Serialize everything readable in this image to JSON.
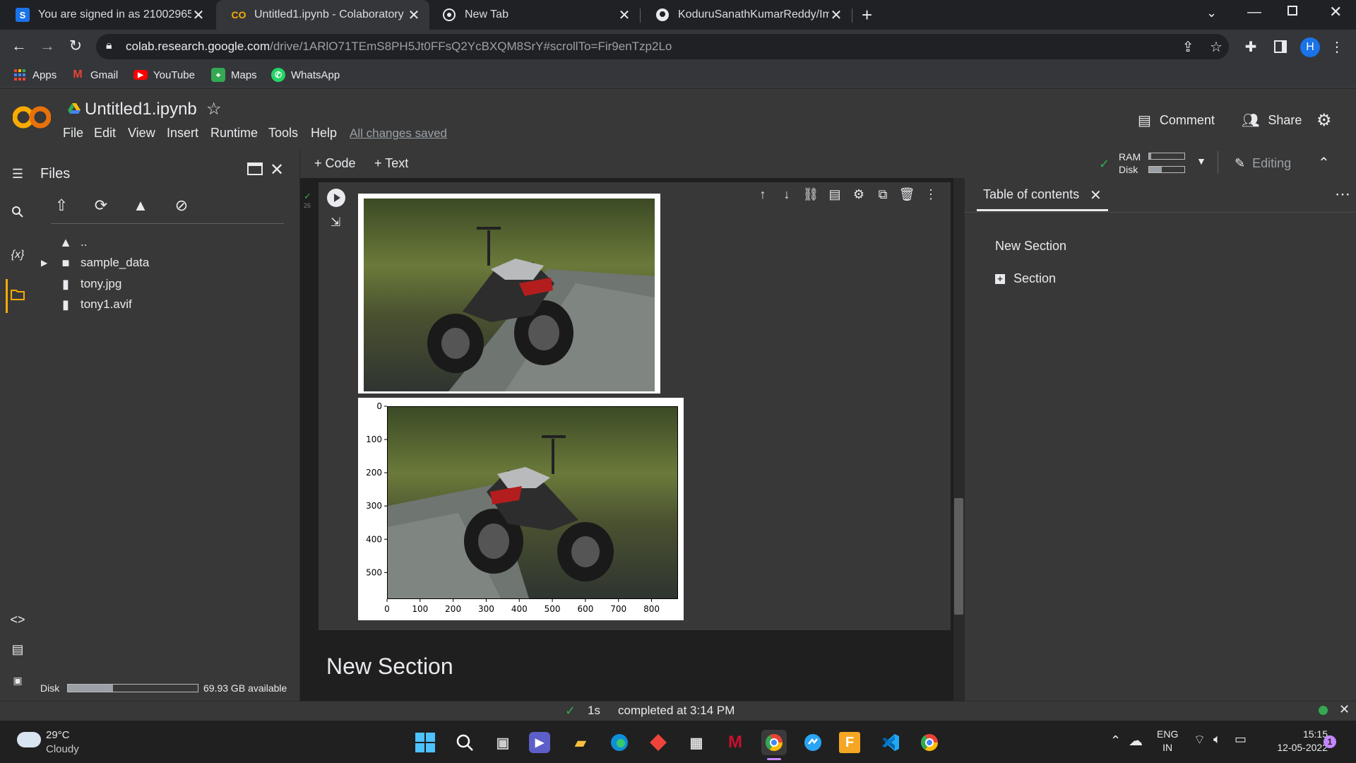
{
  "browser": {
    "tabs": [
      {
        "label": "You are signed in as 21002965",
        "icon": "s-logo-icon",
        "close": "✕"
      },
      {
        "label": "Untitled1.ipynb - Colaboratory",
        "icon": "colab-logo-icon",
        "close": "✕"
      },
      {
        "label": "New Tab",
        "icon": "chrome-icon",
        "close": "✕"
      },
      {
        "label": "KoduruSanathKumarReddy/Imag",
        "icon": "github-icon",
        "close": "✕"
      }
    ],
    "new_tab": "+",
    "url_host": "colab.research.google.com",
    "url_path": "/drive/1ARlO71TEmS8PH5Jt0FFsQ2YcBXQM8SrY#scrollTo=Fir9enTzp2Lo",
    "profile_initial": "H",
    "bookmarks": [
      "Apps",
      "Gmail",
      "YouTube",
      "Maps",
      "WhatsApp"
    ]
  },
  "colab": {
    "title": "Untitled1.ipynb",
    "menu": [
      "File",
      "Edit",
      "View",
      "Insert",
      "Runtime",
      "Tools",
      "Help"
    ],
    "saved_status": "All changes saved",
    "comment_label": "Comment",
    "share_label": "Share",
    "add_code": "+ Code",
    "add_text": "+ Text",
    "ram_label": "RAM",
    "disk_label": "Disk",
    "editing_label": "Editing"
  },
  "files": {
    "title": "Files",
    "items": [
      {
        "name": "..",
        "type": "folder-up"
      },
      {
        "name": "sample_data",
        "type": "folder"
      },
      {
        "name": "tony.jpg",
        "type": "file"
      },
      {
        "name": "tony1.avif",
        "type": "file"
      }
    ],
    "disk_label": "Disk",
    "disk_available": "69.93 GB available",
    "disk_used_fraction": 0.35
  },
  "cell": {
    "exec_count": "26",
    "plot_y_ticks": [
      "0",
      "100",
      "200",
      "300",
      "400",
      "500"
    ],
    "plot_x_ticks": [
      "0",
      "100",
      "200",
      "300",
      "400",
      "500",
      "600",
      "700",
      "800"
    ]
  },
  "notebook": {
    "section_heading": "New Section"
  },
  "toc": {
    "title": "Table of contents",
    "items": [
      "New Section",
      "Section"
    ]
  },
  "status": {
    "duration": "1s",
    "message": "completed at 3:14 PM"
  },
  "taskbar": {
    "temperature": "29°C",
    "weather": "Cloudy",
    "lang1": "ENG",
    "lang2": "IN",
    "time": "15:15",
    "date": "12-05-2022",
    "notification_count": "1"
  },
  "colors": {
    "accent_orange": "#f9ab00",
    "bg_dark": "#1f1f1f",
    "panel": "#383838",
    "status_green": "#34a853"
  }
}
